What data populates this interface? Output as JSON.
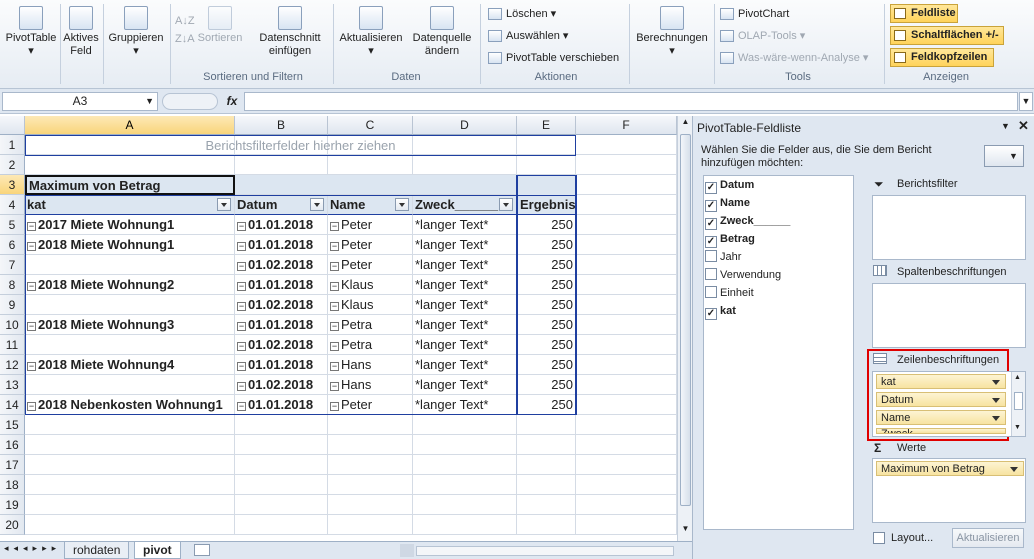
{
  "ribbon": {
    "pivottable": "PivotTable",
    "aktives_feld": "Aktives Feld",
    "gruppieren": "Gruppieren",
    "sortieren": "Sortieren",
    "datenschnitt": "Datenschnitt einfügen",
    "aktualisieren": "Aktualisieren",
    "datenquelle": "Datenquelle ändern",
    "loeschen": "Löschen",
    "auswaehlen": "Auswählen",
    "verschieben": "PivotTable verschieben",
    "berechnungen": "Berechnungen",
    "pivotchart": "PivotChart",
    "olap": "OLAP-Tools",
    "waswaere": "Was-wäre-wenn-Analyse",
    "feldliste": "Feldliste",
    "schaltflaechen": "Schaltflächen +/-",
    "feldkopfzeilen": "Feldkopfzeilen",
    "groups": {
      "sortieren_filtern": "Sortieren und Filtern",
      "daten": "Daten",
      "aktionen": "Aktionen",
      "tools": "Tools",
      "anzeigen": "Anzeigen"
    }
  },
  "formula_bar": {
    "name_box": "A3",
    "fx": "fx",
    "content": ""
  },
  "columns": [
    "A",
    "B",
    "C",
    "D",
    "E",
    "F"
  ],
  "rows": [
    "1",
    "2",
    "3",
    "4",
    "5",
    "6",
    "7",
    "8",
    "9",
    "10",
    "11",
    "12",
    "13",
    "14",
    "15",
    "16",
    "17",
    "18",
    "19",
    "20"
  ],
  "pivot": {
    "filter_placeholder": "Berichtsfilterfelder hierher ziehen",
    "value_header": "Maximum von Betrag",
    "headers": [
      "kat",
      "Datum",
      "Name",
      "Zweck______",
      "Ergebnis"
    ],
    "data": [
      {
        "kat": "2017 Miete Wohnung1",
        "datum": "01.01.2018",
        "name": "Peter",
        "zweck": "*langer Text*",
        "ergebnis": "250"
      },
      {
        "kat": "2018 Miete Wohnung1",
        "datum": "01.01.2018",
        "name": "Peter",
        "zweck": "*langer Text*",
        "ergebnis": "250"
      },
      {
        "kat": "",
        "datum": "01.02.2018",
        "name": "Peter",
        "zweck": "*langer Text*",
        "ergebnis": "250"
      },
      {
        "kat": "2018 Miete Wohnung2",
        "datum": "01.01.2018",
        "name": "Klaus",
        "zweck": "*langer Text*",
        "ergebnis": "250"
      },
      {
        "kat": "",
        "datum": "01.02.2018",
        "name": "Klaus",
        "zweck": "*langer Text*",
        "ergebnis": "250"
      },
      {
        "kat": "2018 Miete Wohnung3",
        "datum": "01.01.2018",
        "name": "Petra",
        "zweck": "*langer Text*",
        "ergebnis": "250"
      },
      {
        "kat": "",
        "datum": "01.02.2018",
        "name": "Petra",
        "zweck": "*langer Text*",
        "ergebnis": "250"
      },
      {
        "kat": "2018 Miete Wohnung4",
        "datum": "01.01.2018",
        "name": "Hans",
        "zweck": "*langer Text*",
        "ergebnis": "250"
      },
      {
        "kat": "",
        "datum": "01.02.2018",
        "name": "Hans",
        "zweck": "*langer Text*",
        "ergebnis": "250"
      },
      {
        "kat": "2018 Nebenkosten Wohnung1",
        "datum": "01.01.2018",
        "name": "Peter",
        "zweck": "*langer Text*",
        "ergebnis": "250"
      }
    ]
  },
  "sheet_tabs": [
    "rohdaten",
    "pivot"
  ],
  "field_list": {
    "title": "PivotTable-Feldliste",
    "instruction": "Wählen Sie die Felder aus, die Sie dem Bericht hinzufügen möchten:",
    "fields": [
      {
        "label": "Datum",
        "checked": true
      },
      {
        "label": "Name",
        "checked": true
      },
      {
        "label": "Zweck______",
        "checked": true
      },
      {
        "label": "Betrag",
        "checked": true
      },
      {
        "label": "Jahr",
        "checked": false
      },
      {
        "label": "Verwendung",
        "checked": false
      },
      {
        "label": "Einheit",
        "checked": false
      },
      {
        "label": "kat",
        "checked": true
      }
    ],
    "areas": {
      "berichtsfilter": "Berichtsfilter",
      "spalten": "Spaltenbeschriftungen",
      "zeilen": "Zeilenbeschriftungen",
      "werte": "Werte"
    },
    "row_items": [
      "kat",
      "Datum",
      "Name",
      "Zweck"
    ],
    "value_items": [
      "Maximum von Betrag"
    ],
    "layout_label": "Layout...",
    "update_button": "Aktualisieren"
  },
  "colors": {
    "highlight_box": "#e00000",
    "pivot_border": "#1f3fa0",
    "header_bg": "#dce6f1"
  }
}
